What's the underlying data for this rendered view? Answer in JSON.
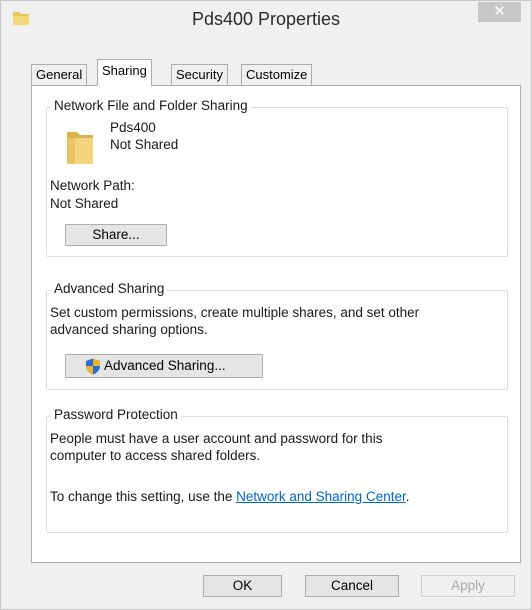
{
  "window": {
    "title": "Pds400 Properties",
    "close_glyph": "✕"
  },
  "tabs": [
    {
      "label": "General",
      "active": false
    },
    {
      "label": "Sharing",
      "active": true
    },
    {
      "label": "Security",
      "active": false
    },
    {
      "label": "Customize",
      "active": false
    }
  ],
  "network_sharing": {
    "group_title": "Network File and Folder Sharing",
    "folder_name": "Pds400",
    "folder_status": "Not Shared",
    "path_label": "Network Path:",
    "path_value": "Not Shared",
    "share_button": "Share..."
  },
  "advanced_sharing": {
    "group_title": "Advanced Sharing",
    "description": "Set custom permissions, create multiple shares, and set other advanced sharing options.",
    "button": "Advanced Sharing..."
  },
  "password_protection": {
    "group_title": "Password Protection",
    "description": "People must have a user account and password for this computer to access shared folders.",
    "change_prefix": "To change this setting, use the ",
    "link": "Network and Sharing Center",
    "change_suffix": "."
  },
  "footer": {
    "ok": "OK",
    "cancel": "Cancel",
    "apply": "Apply"
  },
  "icons": {
    "title": "folder-icon",
    "folder": "folder-icon",
    "shield": "uac-shield-icon"
  },
  "colors": {
    "link": "#0066cc",
    "group_border": "#d5dfe5",
    "close_bg": "#c7c7c7"
  }
}
